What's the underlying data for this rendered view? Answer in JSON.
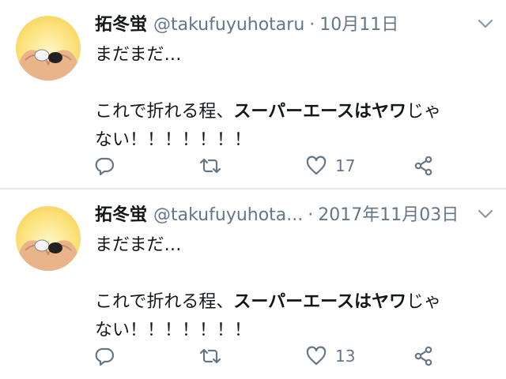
{
  "tweets": [
    {
      "display_name": "拓冬蛍",
      "handle": "@takufuyuhotaru",
      "separator": "·",
      "date": "10月11日",
      "line1": "まだまだ…",
      "line2_a": "これで折れる程、",
      "line2_b": "スーパーエースは",
      "line2_c": "ヤワ",
      "line2_d": "じゃ",
      "line3": "ない！！！！！！！",
      "like_count": "17",
      "icons": [
        "reply-icon",
        "retweet-icon",
        "like-icon",
        "share-icon",
        "chevron-down-icon"
      ]
    },
    {
      "display_name": "拓冬蛍",
      "handle": "@takufuyuhota...",
      "separator": "·",
      "date": "2017年11月03日",
      "line1": "まだまだ…",
      "line2_a": "これで折れる程、",
      "line2_b": "スーパーエースは",
      "line2_c": "ヤワ",
      "line2_d": "じゃ",
      "line3": "ない！！！！！！！",
      "like_count": "13",
      "icons": [
        "reply-icon",
        "retweet-icon",
        "like-icon",
        "share-icon",
        "chevron-down-icon"
      ]
    }
  ],
  "colors": {
    "text": "#14171a",
    "secondary": "#657786",
    "divider": "#e1e8ed",
    "avatar_bg": "#fbe27a"
  }
}
